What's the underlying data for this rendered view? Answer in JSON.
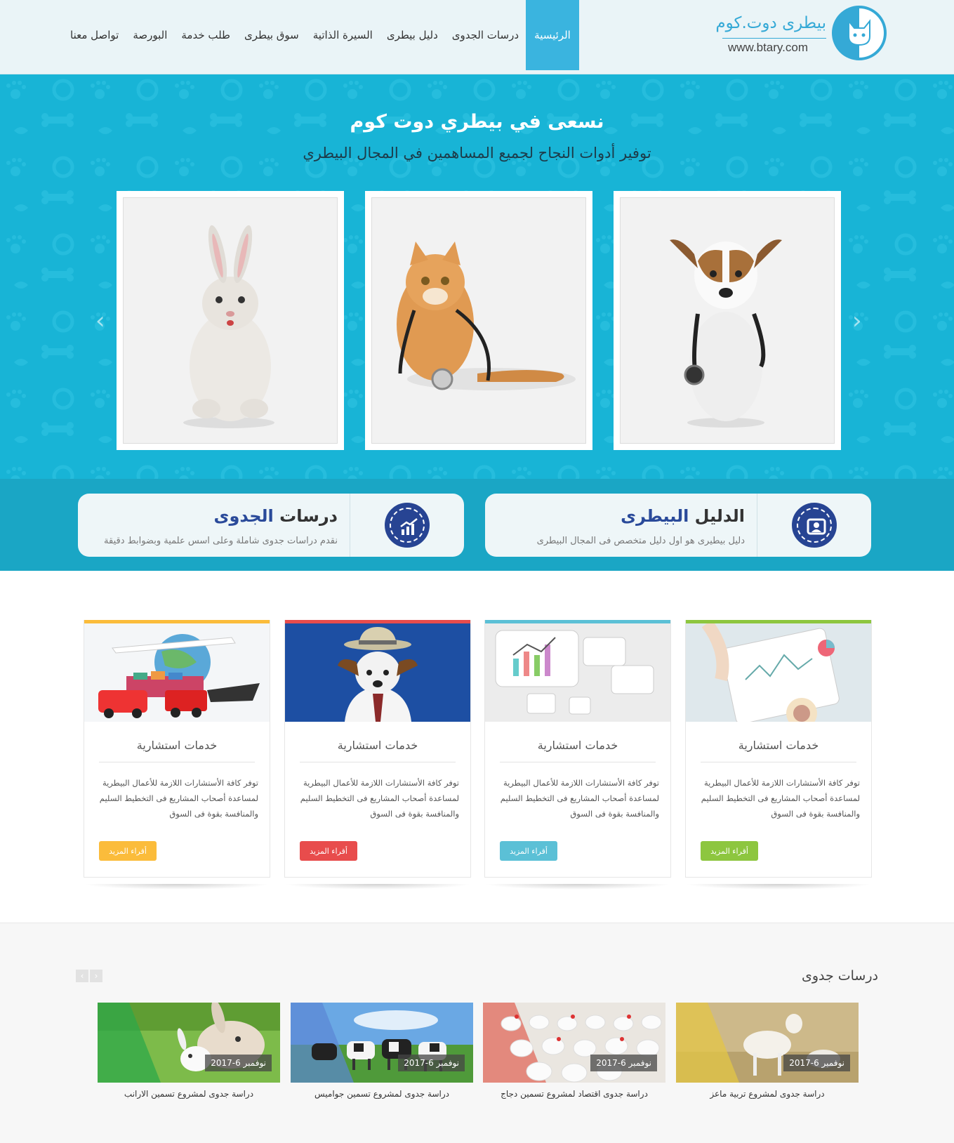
{
  "header": {
    "logo_ar": "بيطرى دوت.كوم",
    "logo_url": "www.btary.com",
    "nav": [
      "الرئيسية",
      "درسات الجدوى",
      "دليل بيطرى",
      "السيرة الذاتية",
      "سوق بيطرى",
      "طلب خدمة",
      "البورصة",
      "تواصل معنا"
    ],
    "active_nav": "الرئيسية",
    "accent_color": "#3ab4df"
  },
  "hero": {
    "title": "نسعى في بيطري دوت كوم",
    "subtitle": "توفير أدوات النجاح لجميع المساهمين في المجال البيطري",
    "slides": [
      "rabbit-image",
      "cat-stethoscope-image",
      "dog-stethoscope-image"
    ],
    "prev_icon": "chevron-left-icon",
    "next_icon": "chevron-right-icon"
  },
  "features": [
    {
      "title_plain": "الدليل ",
      "title_highlight": "البيطرى",
      "desc": "دليل بيطيرى هو اول دليل متخصص فى المجال البيطرى",
      "icon": "directory-icon"
    },
    {
      "title_plain": "درسات ",
      "title_highlight": "الجدوى",
      "desc": "نقدم دراسات جدوى شاملة وعلى اسس علمية وبضوابط دقيقة",
      "icon": "chart-icon"
    }
  ],
  "services": [
    {
      "title": "خدمات استشارية",
      "text": "توفر كافة الأستشارات اللازمة للأعمال البيطرية لمساعدة أصحاب المشاريع فى التخطيط السليم والمنافسة بقوة فى السوق",
      "button": "أقراء المزيد",
      "color": "#8dc63f"
    },
    {
      "title": "خدمات استشارية",
      "text": "توفر كافة الأستشارات اللازمة للأعمال البيطرية لمساعدة أصحاب المشاريع فى التخطيط السليم والمنافسة بقوة فى السوق",
      "button": "أقراء المزيد",
      "color": "#5bc0d6"
    },
    {
      "title": "خدمات استشارية",
      "text": "توفر كافة الأستشارات اللازمة للأعمال البيطرية لمساعدة أصحاب المشاريع فى التخطيط السليم والمنافسة بقوة فى السوق",
      "button": "أقراء المزيد",
      "color": "#e84c4c"
    },
    {
      "title": "خدمات استشارية",
      "text": "توفر كافة الأستشارات اللازمة للأعمال البيطرية لمساعدة أصحاب المشاريع فى التخطيط السليم والمنافسة بقوة فى السوق",
      "button": "أقراء المزيد",
      "color": "#fbbc3b"
    }
  ],
  "studies": {
    "title": "درسات جدوى",
    "nav": [
      "‹",
      "›"
    ],
    "items": [
      {
        "date": "نوفمبر 6-2017",
        "caption": "دراسة جدوى لمشروع تربية ماعز"
      },
      {
        "date": "نوفمبر 6-2017",
        "caption": "دراسة جدوى اقتصاد لمشروع تسمين دجاج"
      },
      {
        "date": "نوفمبر 6-2017",
        "caption": "دراسة جدوى لمشروع تسمين جواميس"
      },
      {
        "date": "نوفمبر 6-2017",
        "caption": "دراسة جدوى لمشروع تسمين الارانب"
      }
    ]
  }
}
